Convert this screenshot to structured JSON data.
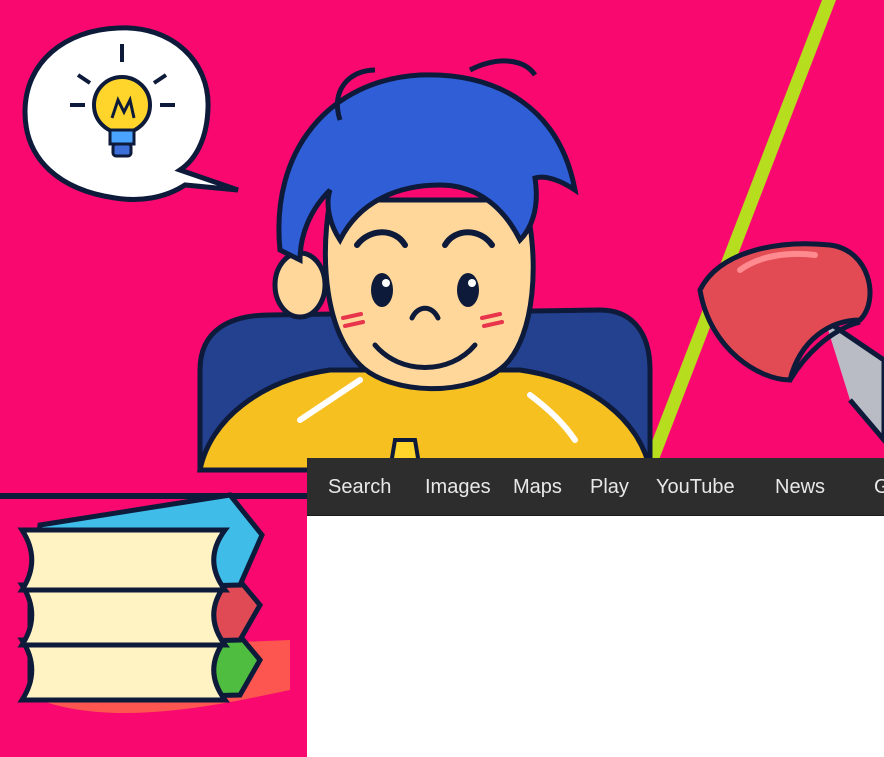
{
  "background": {
    "color": "#f9096f",
    "accent_line": "#b6de1e"
  },
  "illustration": {
    "subject": "boy-studying-illustration",
    "thought_bubble_icon": "lightbulb-icon"
  },
  "navbar": {
    "bg": "#2d2d2d",
    "items": [
      {
        "label": "Search"
      },
      {
        "label": "Images"
      },
      {
        "label": "Maps"
      },
      {
        "label": "Play"
      },
      {
        "label": "YouTube"
      },
      {
        "label": "News"
      },
      {
        "label": "G"
      }
    ]
  }
}
